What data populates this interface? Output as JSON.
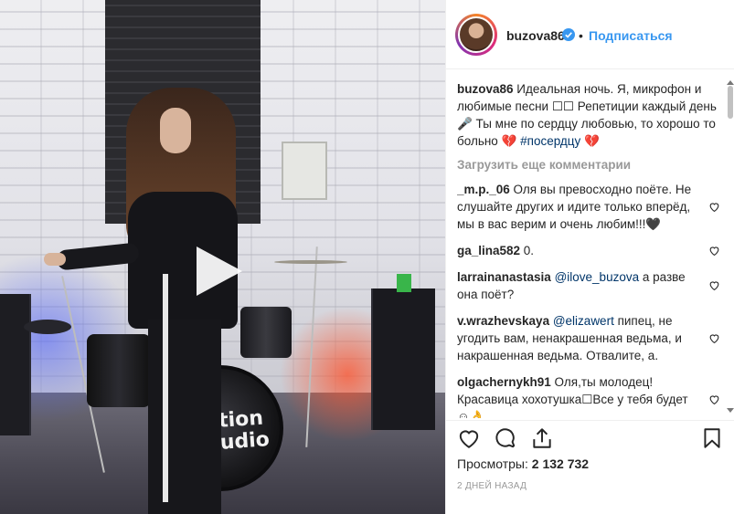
{
  "post": {
    "username": "buzova86",
    "follow_label": "Подписаться",
    "caption_user": "buzova86",
    "caption_text": " Идеальная ночь. Я, микрофон и любимые песни ☐☐ Репетиции каждый день 🎤 Ты мне по сердцу любовью, то хорошо то больно 💔 ",
    "caption_hashtag": "#посердцу",
    "caption_tail": " 💔",
    "load_more": "Загрузить еще комментарии"
  },
  "comments": [
    {
      "user": "_m.p._06",
      "text": " Оля вы превосходно поёте. Не слушайте других и идите только вперёд, мы в вас верим и очень любим!!!🖤"
    },
    {
      "user": "ga_lina582",
      "text": " 0."
    },
    {
      "user": "larrainanastasia",
      "mention": "@ilove_buzova",
      "text": " а разве она поёт?"
    },
    {
      "user": "v.wrazhevskaya",
      "mention": "@elizawert",
      "text": " пипец, не угодить вам, ненакрашенная ведьма, и накрашенная ведьма. Отвалите, а."
    },
    {
      "user": "olgachernykh91",
      "text": " Оля,ты молодец! Красавица хохотушка☐Все у тебя будет☺👌"
    }
  ],
  "media": {
    "kick_drum_text": "tion\nudio"
  },
  "stats": {
    "views_label": "Просмотры:",
    "views_count": "2 132 732",
    "date": "2 дней назад"
  },
  "icons": {
    "like": "heart-icon",
    "comment": "comment-icon",
    "share": "share-icon",
    "save": "bookmark-icon",
    "play": "play-icon",
    "verified": "verified-badge-icon"
  },
  "colors": {
    "link": "#3897f0",
    "verified": "#3897f0",
    "muted": "#999999",
    "text": "#262626",
    "hashtag": "#003569"
  }
}
